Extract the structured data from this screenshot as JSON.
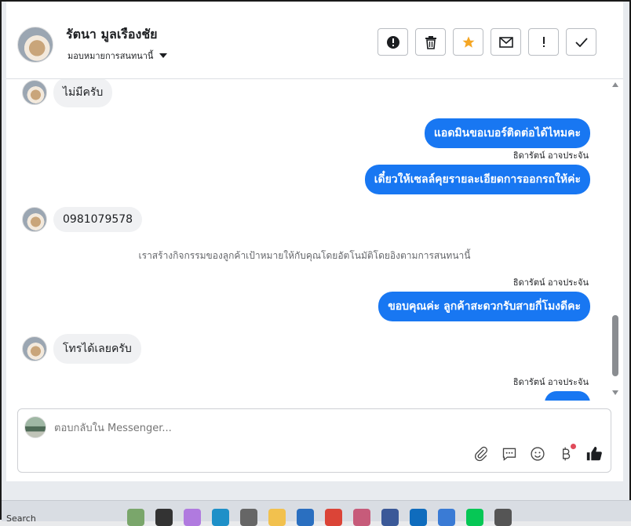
{
  "header": {
    "contact_name": "รัตนา มูลเรืองชัย",
    "assign_label": "มอบหมายการสนทนานี้",
    "actions": [
      {
        "name": "spam",
        "icon": "alert-circle-icon"
      },
      {
        "name": "delete",
        "icon": "trash-icon"
      },
      {
        "name": "star",
        "icon": "star-icon",
        "color": "#f5a623"
      },
      {
        "name": "mark-unread",
        "icon": "envelope-icon"
      },
      {
        "name": "follow-up",
        "icon": "exclamation-icon"
      },
      {
        "name": "done",
        "icon": "check-icon"
      }
    ]
  },
  "messages": [
    {
      "direction": "in",
      "text": "ไม่มีครับ"
    },
    {
      "direction": "out",
      "text": "แอดมินขอเบอร์ติดต่อได้ไหมคะ"
    },
    {
      "direction": "sender",
      "text": "ธิดารัตน์ อาจประจัน"
    },
    {
      "direction": "out",
      "text": "เดี๋ยวให้เซลล์คุยรายละเอียดการออกรถให้ค่ะ"
    },
    {
      "direction": "in",
      "text": "0981079578"
    },
    {
      "direction": "system",
      "text": "เราสร้างกิจกรรมของลูกค้าเป้าหมายให้กับคุณโดยอัตโนมัติโดยอิงตามการสนทนานี้"
    },
    {
      "direction": "sender",
      "text": "ธิดารัตน์ อาจประจัน"
    },
    {
      "direction": "out",
      "text": "ขอบคุณค่ะ ลูกค้าสะดวกรับสายกี่โมงดีคะ"
    },
    {
      "direction": "in",
      "text": "โทรได้เลยครับ"
    },
    {
      "direction": "sender",
      "text": "ธิดารัตน์ อาจประจัน"
    }
  ],
  "composer": {
    "placeholder": "ตอบกลับใน Messenger...",
    "tools": [
      "attach-icon",
      "saved-replies-icon",
      "emoji-icon",
      "payment-baht-icon",
      "like-icon"
    ],
    "accent": "#1877f2"
  },
  "taskbar": {
    "search_label": "Search"
  }
}
